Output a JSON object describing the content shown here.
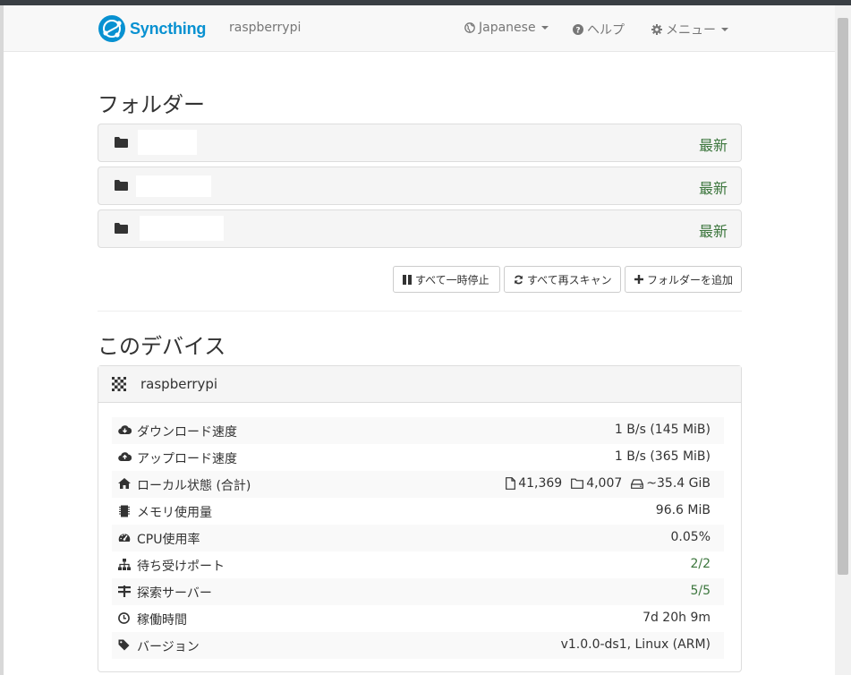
{
  "navbar": {
    "brand": "Syncthing",
    "device": "raspberrypi",
    "language": "Japanese",
    "help": "ヘルプ",
    "menu": "メニュー"
  },
  "folders": {
    "heading": "フォルダー",
    "items": [
      {
        "status": "最新"
      },
      {
        "status": "最新"
      },
      {
        "status": "最新"
      }
    ],
    "buttons": {
      "pause_all": "すべて一時停止",
      "rescan_all": "すべて再スキャン",
      "add_folder": "フォルダーを追加"
    }
  },
  "this_device": {
    "heading": "このデバイス",
    "name": "raspberrypi",
    "rows": [
      {
        "icon": "cloud-download-icon",
        "label": "ダウンロード速度",
        "value": "1 B/s (145 MiB)"
      },
      {
        "icon": "cloud-upload-icon",
        "label": "アップロード速度",
        "value": "1 B/s (365 MiB)"
      },
      {
        "icon": "home-icon",
        "label": "ローカル状態 (合計)",
        "files": "41,369",
        "dirs": "4,007",
        "size": "~35.4 GiB"
      },
      {
        "icon": "memory-icon",
        "label": "メモリ使用量",
        "value": "96.6 MiB"
      },
      {
        "icon": "dashboard-icon",
        "label": "CPU使用率",
        "value": "0.05%"
      },
      {
        "icon": "sitemap-icon",
        "label": "待ち受けポート",
        "value": "2/2"
      },
      {
        "icon": "discovery-icon",
        "label": "探索サーバー",
        "value": "5/5"
      },
      {
        "icon": "clock-icon",
        "label": "稼働時間",
        "value": "7d 20h 9m"
      },
      {
        "icon": "tag-icon",
        "label": "バージョン",
        "value": "v1.0.0-ds1, Linux (ARM)"
      }
    ]
  },
  "colors": {
    "brand": "#0891d1",
    "status_green": "#3c763d"
  }
}
